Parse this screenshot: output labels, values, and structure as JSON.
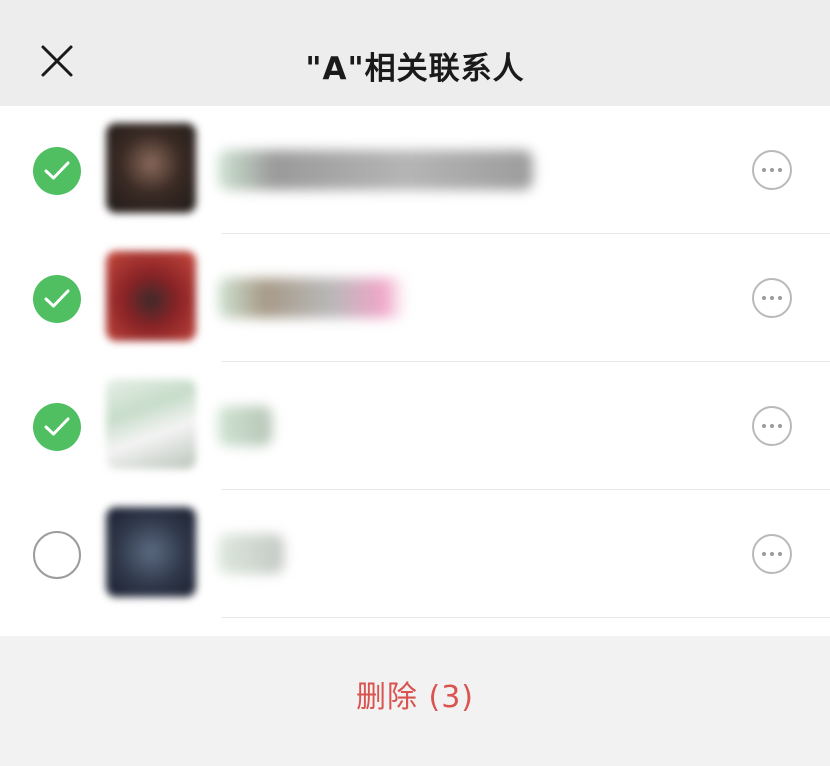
{
  "header": {
    "title": "\"A\"相关联系人",
    "close_icon": "close-icon"
  },
  "contacts": [
    {
      "selected": true,
      "avatar": "avatar-image",
      "name_blurred": true
    },
    {
      "selected": true,
      "avatar": "avatar-image",
      "name_blurred": true
    },
    {
      "selected": true,
      "avatar": "avatar-image",
      "name_blurred": true
    },
    {
      "selected": false,
      "avatar": "avatar-image",
      "name_blurred": true
    }
  ],
  "footer": {
    "delete_label": "删除 (3)"
  },
  "colors": {
    "check_green": "#4fbf62",
    "delete_red": "#d9534f",
    "header_bg": "#ededed",
    "footer_bg": "#f2f2f2"
  }
}
